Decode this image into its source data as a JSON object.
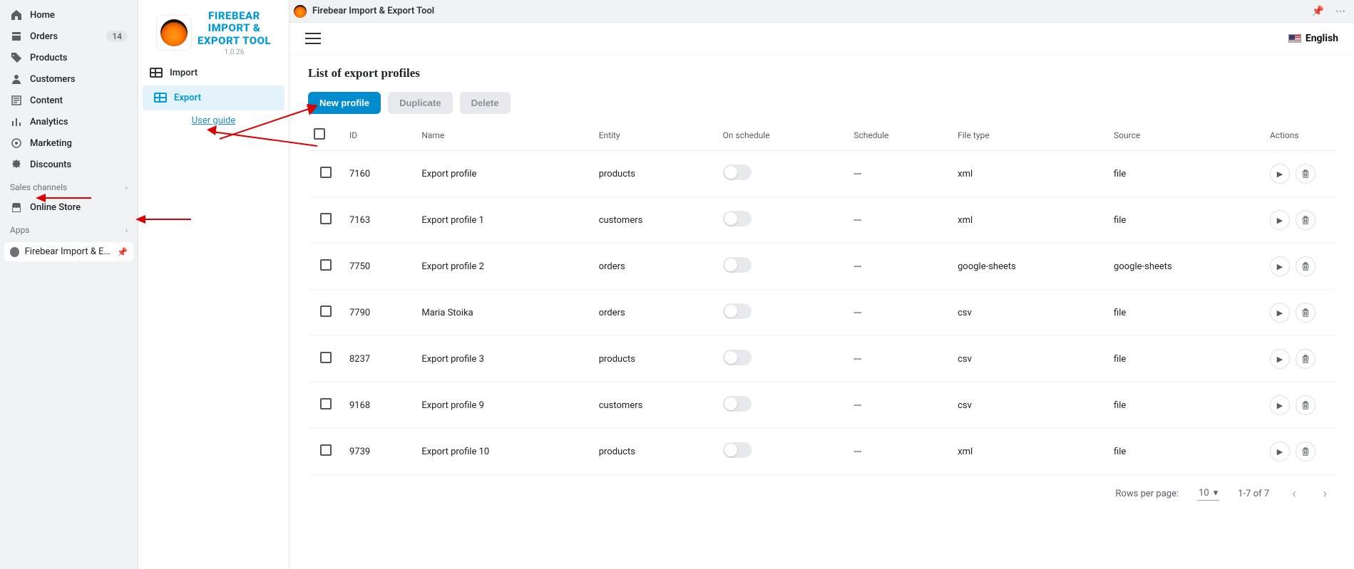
{
  "shopify_nav": {
    "items": [
      {
        "label": "Home",
        "icon": "home"
      },
      {
        "label": "Orders",
        "icon": "orders",
        "badge": "14"
      },
      {
        "label": "Products",
        "icon": "tag"
      },
      {
        "label": "Customers",
        "icon": "user"
      },
      {
        "label": "Content",
        "icon": "content"
      },
      {
        "label": "Analytics",
        "icon": "analytics"
      },
      {
        "label": "Marketing",
        "icon": "target"
      },
      {
        "label": "Discounts",
        "icon": "discount"
      }
    ],
    "section_sales": "Sales channels",
    "online_store": "Online Store",
    "section_apps": "Apps",
    "app_item": "Firebear Import & Exp..."
  },
  "top_strip": {
    "title": "Firebear Import & Export Tool"
  },
  "app_brand": {
    "title_line1": "FIREBEAR",
    "title_line2": "IMPORT &",
    "title_line3": "EXPORT TOOL",
    "version": "1.0.26"
  },
  "side_nav": {
    "import": "Import",
    "export": "Export",
    "user_guide": "User guide"
  },
  "header": {
    "language": "English"
  },
  "page": {
    "title": "List of export profiles"
  },
  "buttons": {
    "new": "New profile",
    "duplicate": "Duplicate",
    "delete": "Delete"
  },
  "table": {
    "headers": {
      "id": "ID",
      "name": "Name",
      "entity": "Entity",
      "on_schedule": "On schedule",
      "schedule": "Schedule",
      "file_type": "File type",
      "source": "Source",
      "actions": "Actions"
    },
    "rows": [
      {
        "id": "7160",
        "name": "Export profile",
        "entity": "products",
        "schedule": "---",
        "file_type": "xml",
        "source": "file"
      },
      {
        "id": "7163",
        "name": "Export profile 1",
        "entity": "customers",
        "schedule": "---",
        "file_type": "xml",
        "source": "file"
      },
      {
        "id": "7750",
        "name": "Export profile 2",
        "entity": "orders",
        "schedule": "---",
        "file_type": "google-sheets",
        "source": "google-sheets"
      },
      {
        "id": "7790",
        "name": "Maria Stoika",
        "entity": "orders",
        "schedule": "---",
        "file_type": "csv",
        "source": "file"
      },
      {
        "id": "8237",
        "name": "Export profile 3",
        "entity": "products",
        "schedule": "---",
        "file_type": "csv",
        "source": "file"
      },
      {
        "id": "9168",
        "name": "Export profile 9",
        "entity": "customers",
        "schedule": "---",
        "file_type": "csv",
        "source": "file"
      },
      {
        "id": "9739",
        "name": "Export profile 10",
        "entity": "products",
        "schedule": "---",
        "file_type": "xml",
        "source": "file"
      }
    ]
  },
  "pager": {
    "rpp_label": "Rows per page:",
    "rpp_value": "10",
    "range": "1-7 of 7"
  }
}
